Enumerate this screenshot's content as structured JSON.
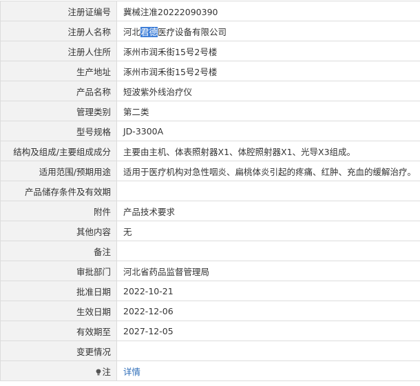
{
  "rows": [
    {
      "label": "注册证编号",
      "value": "冀械注准20222090390"
    },
    {
      "label": "注册人名称",
      "value_before": "河北",
      "value_highlight": "君德",
      "value_after": "医疗设备有限公司"
    },
    {
      "label": "注册人住所",
      "value": "涿州市润禾街15号2号楼"
    },
    {
      "label": "生产地址",
      "value": "涿州市润禾街15号2号楼"
    },
    {
      "label": "产品名称",
      "value": "短波紫外线治疗仪"
    },
    {
      "label": "管理类别",
      "value": "第二类"
    },
    {
      "label": "型号规格",
      "value": "JD-3300A"
    },
    {
      "label": "结构及组成/主要组成成分",
      "value": "主要由主机、体表照射器X1、体腔照射器X1、光导X3组成。"
    },
    {
      "label": "适用范围/预期用途",
      "value": "适用于医疗机构对急性咽炎、扁桃体炎引起的疼痛、红肿、充血的缓解治疗。"
    },
    {
      "label": "产品储存条件及有效期",
      "value": ""
    },
    {
      "label": "附件",
      "value": "产品技术要求"
    },
    {
      "label": "其他内容",
      "value": "无"
    },
    {
      "label": "备注",
      "value": ""
    },
    {
      "label": "审批部门",
      "value": "河北省药品监督管理局"
    },
    {
      "label": "批准日期",
      "value": "2022-10-21"
    },
    {
      "label": "生效日期",
      "value": "2022-12-06"
    },
    {
      "label": "有效期至",
      "value": "2027-12-05"
    },
    {
      "label": "变更情况",
      "value": ""
    },
    {
      "label": "注",
      "link": "详情",
      "icon": "lightbulb-icon"
    }
  ],
  "colors": {
    "label_bg": "#f2f2f2",
    "border": "#dcdcdc",
    "selection": "#3f7fd8",
    "link": "#2e6db8"
  }
}
